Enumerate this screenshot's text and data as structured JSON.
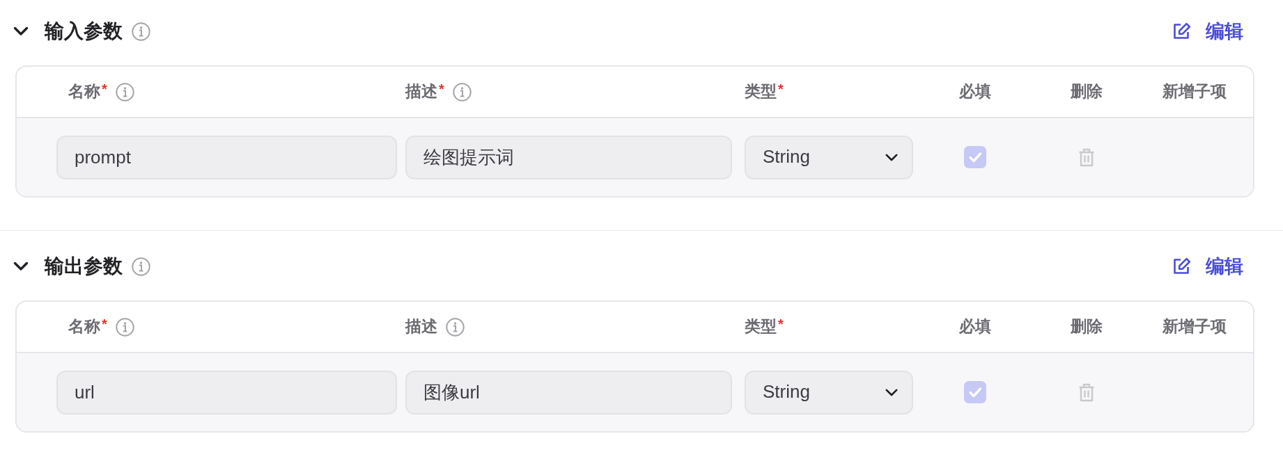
{
  "sections": [
    {
      "title": "输入参数",
      "expanded": true,
      "info_icon": true,
      "edit_label": "编辑",
      "columns": [
        {
          "label": "名称",
          "required_mark": "*",
          "info_icon": true
        },
        {
          "label": "描述",
          "required_mark": "*",
          "info_icon": true
        },
        {
          "label": "类型",
          "required_mark": "*",
          "info_icon": false
        },
        {
          "label": "必填",
          "info_icon": false
        },
        {
          "label": "删除",
          "info_icon": false
        },
        {
          "label": "新增子项",
          "info_icon": false
        }
      ],
      "rows": [
        {
          "name": "prompt",
          "description": "绘图提示词",
          "type": "String",
          "required_checked": true,
          "required_disabled": true,
          "delete_disabled": true
        }
      ]
    },
    {
      "title": "输出参数",
      "expanded": true,
      "info_icon": true,
      "edit_label": "编辑",
      "columns": [
        {
          "label": "名称",
          "required_mark": "*",
          "info_icon": true
        },
        {
          "label": "描述",
          "info_icon": true
        },
        {
          "label": "类型",
          "required_mark": "*",
          "info_icon": false
        },
        {
          "label": "必填",
          "info_icon": false
        },
        {
          "label": "删除",
          "info_icon": false
        },
        {
          "label": "新增子项",
          "info_icon": false
        }
      ],
      "rows": [
        {
          "name": "url",
          "description": "图像url",
          "type": "String",
          "required_checked": true,
          "required_disabled": true,
          "delete_disabled": true
        }
      ]
    }
  ]
}
